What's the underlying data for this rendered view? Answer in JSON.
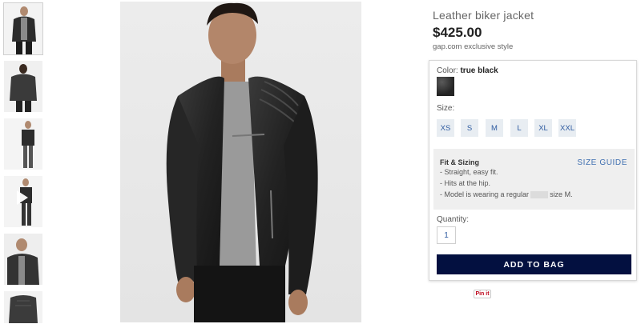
{
  "product": {
    "title": "Leather biker jacket",
    "price": "$425.00",
    "exclusive_note": "gap.com exclusive style"
  },
  "color": {
    "label": "Color:",
    "selected": "true black",
    "swatch_hex": "#2e2e2e"
  },
  "size": {
    "label": "Size:",
    "options": [
      "XS",
      "S",
      "M",
      "L",
      "XL",
      "XXL"
    ]
  },
  "fit": {
    "title": "Fit & Sizing",
    "guide_label": "SIZE GUIDE",
    "line1": "- Straight, easy fit.",
    "line2": "- Hits at the hip.",
    "line3_prefix": "- Model is wearing a regular",
    "line3_suffix": "size M."
  },
  "quantity": {
    "label": "Quantity:",
    "value": "1"
  },
  "actions": {
    "add_to_bag": "ADD TO BAG",
    "pin_it": "Pin it"
  },
  "thumbnails": [
    {
      "icon": "thumbnail-front"
    },
    {
      "icon": "thumbnail-back"
    },
    {
      "icon": "thumbnail-full-length"
    },
    {
      "icon": "thumbnail-video",
      "has_play": true
    },
    {
      "icon": "thumbnail-detail"
    },
    {
      "icon": "thumbnail-flat"
    }
  ],
  "colors": {
    "brand_navy": "#031040",
    "link_blue": "#3f6fb0",
    "size_chip_bg": "#e8edf2"
  }
}
